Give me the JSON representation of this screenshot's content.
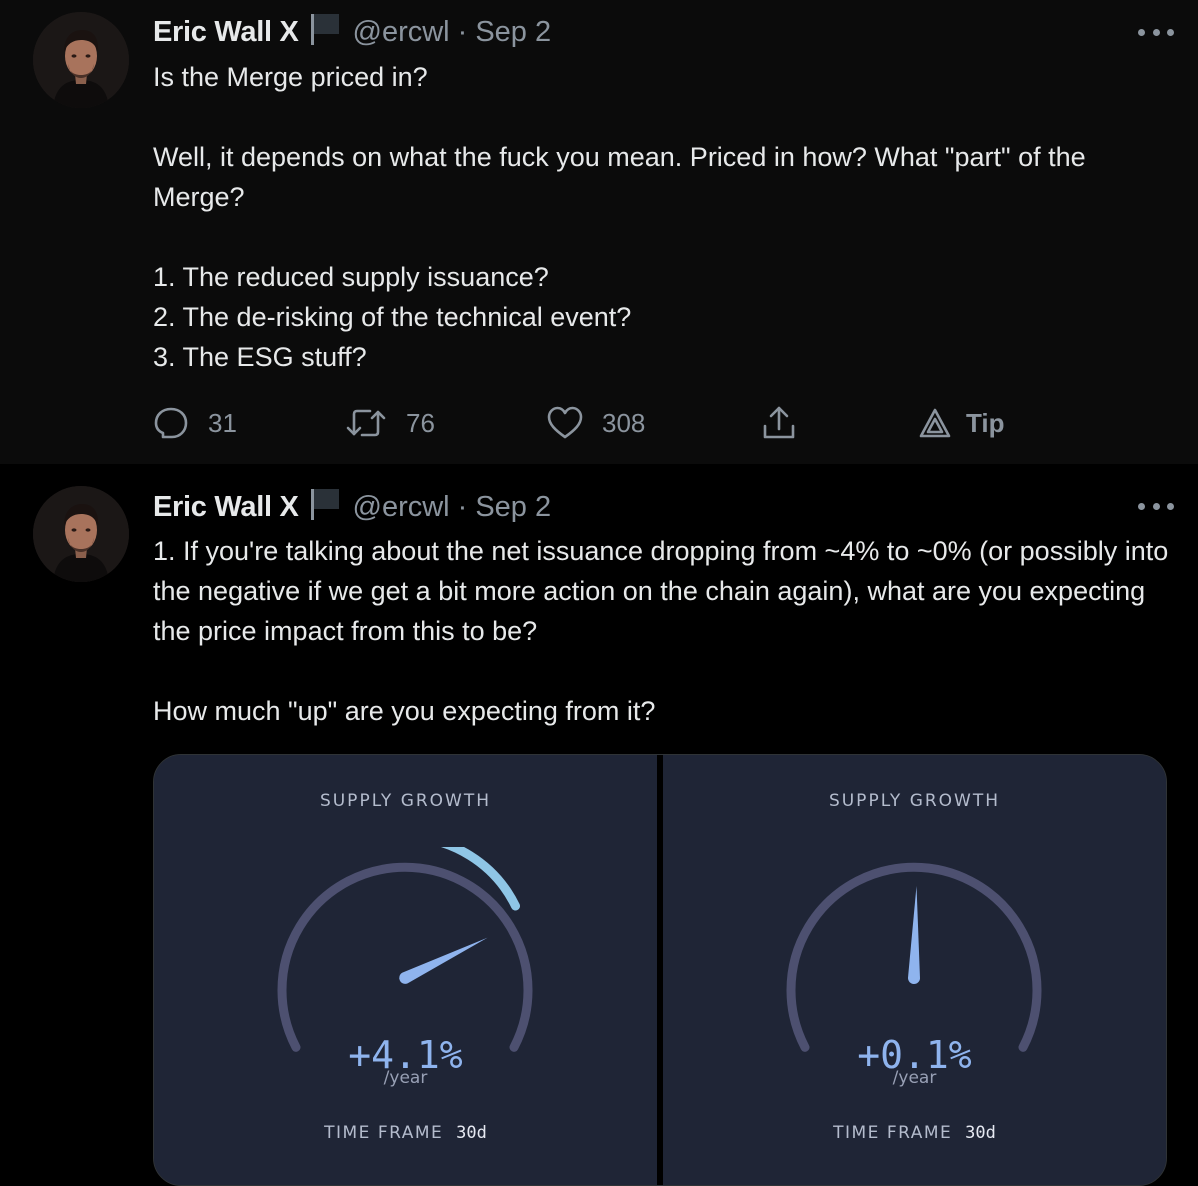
{
  "tweets": [
    {
      "author": {
        "name": "Eric Wall X",
        "handle": "@ercwl",
        "separator": "·",
        "date": "Sep 2"
      },
      "paragraphs": [
        "Is the Merge priced in?",
        "Well, it depends on what the fuck you mean. Priced in how? What \"part\" of the Merge?",
        "1. The reduced supply issuance?",
        "2. The de-risking of the technical event?",
        "3. The ESG stuff?"
      ],
      "actions": {
        "replies": "31",
        "retweets": "76",
        "likes": "308",
        "tip_label": "Tip"
      }
    },
    {
      "author": {
        "name": "Eric Wall X",
        "handle": "@ercwl",
        "separator": "·",
        "date": "Sep 2"
      },
      "paragraphs": [
        "1. If you're talking about the net issuance dropping from ~4% to ~0% (or possibly into the negative if we get a bit more action on the chain again), what are you expecting the price impact from this to be?",
        "How much \"up\" are you expecting from it?"
      ],
      "media": {
        "gauges": [
          {
            "title": "SUPPLY GROWTH",
            "value": "+4.1%",
            "value_num": 4.1,
            "unit": "/year",
            "timeframe_label": "TIME FRAME",
            "timeframe": "30d"
          },
          {
            "title": "SUPPLY GROWTH",
            "value": "+0.1%",
            "value_num": 0.1,
            "unit": "/year",
            "timeframe_label": "TIME FRAME",
            "timeframe": "30d"
          }
        ]
      }
    }
  ],
  "icons": {
    "reply": "reply-icon",
    "retweet": "retweet-icon",
    "like": "heart-icon",
    "share": "share-icon",
    "tip": "tip-icon",
    "more": "more-icon",
    "flag": "flag-icon"
  },
  "colors": {
    "background": "#000000",
    "first_tweet_background": "#0b0b0b",
    "text": "#e7e9ea",
    "muted": "#8b949e",
    "gauge_panel": "#1f2536",
    "gauge_track": "#4d5070",
    "gauge_value": "#8fb4ee"
  }
}
